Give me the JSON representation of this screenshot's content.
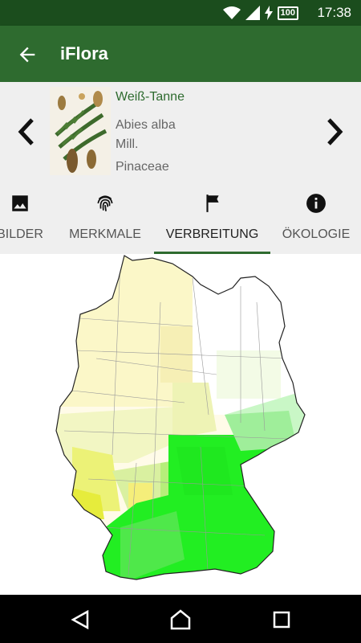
{
  "status_bar": {
    "time": "17:38",
    "battery": "100",
    "icons": [
      "wifi-icon",
      "signal-icon",
      "charging-icon",
      "battery-icon"
    ]
  },
  "app_bar": {
    "title": "iFlora",
    "back_icon": "arrow-back-icon"
  },
  "species": {
    "common_name": "Weiß-Tanne",
    "latin_name": "Abies alba",
    "author": "Mill.",
    "family": "Pinaceae"
  },
  "tabs": [
    {
      "label": "BILDER",
      "icon": "image-icon",
      "active": false
    },
    {
      "label": "MERKMALE",
      "icon": "fingerprint-icon",
      "active": false
    },
    {
      "label": "VERBREITUNG",
      "icon": "flag-icon",
      "active": true
    },
    {
      "label": "ÖKOLOGIE",
      "icon": "info-icon",
      "active": false
    }
  ],
  "colors": {
    "accent": "#2e6b2f",
    "status_bar": "#1b4d1d",
    "map_high": "#22ee22",
    "map_low": "#fffde0"
  },
  "nav_bar": {
    "icons": [
      "back-triangle-icon",
      "home-circle-icon",
      "recents-square-icon"
    ]
  }
}
